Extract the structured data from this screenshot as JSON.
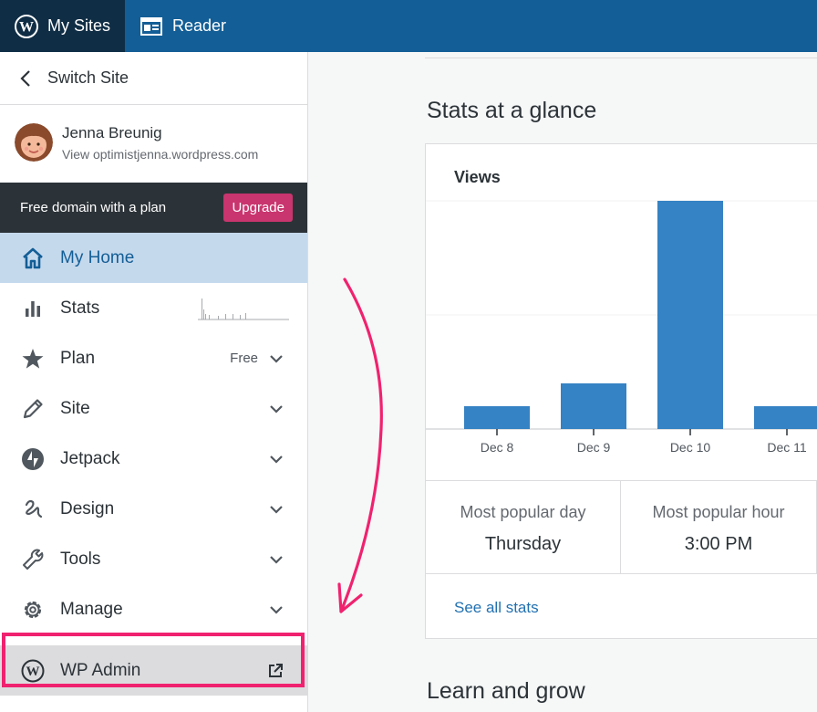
{
  "masterbar": {
    "my_sites": "My Sites",
    "reader": "Reader"
  },
  "sidebar": {
    "switch_site": "Switch Site",
    "site": {
      "name": "Jenna Breunig",
      "url": "View optimistjenna.wordpress.com"
    },
    "upsell": {
      "text": "Free domain with a plan",
      "button": "Upgrade"
    },
    "items": [
      {
        "label": "My Home",
        "icon": "home-icon"
      },
      {
        "label": "Stats",
        "icon": "stats-icon"
      },
      {
        "label": "Plan",
        "icon": "star-icon",
        "badge": "Free"
      },
      {
        "label": "Site",
        "icon": "pencil-icon"
      },
      {
        "label": "Jetpack",
        "icon": "jetpack-icon"
      },
      {
        "label": "Design",
        "icon": "design-icon"
      },
      {
        "label": "Tools",
        "icon": "wrench-icon"
      },
      {
        "label": "Manage",
        "icon": "gear-icon"
      },
      {
        "label": "WP Admin",
        "icon": "wordpress-icon"
      }
    ]
  },
  "main": {
    "stats_title": "Stats at a glance",
    "card_title": "Views",
    "popular_day_label": "Most popular day",
    "popular_day_value": "Thursday",
    "popular_hour_label": "Most popular hour",
    "popular_hour_value": "3:00 PM",
    "see_all": "See all stats",
    "learn_title": "Learn and grow"
  },
  "colors": {
    "masterbar": "#135e96",
    "bar": "#3582c4",
    "accent_pink": "#f0226f",
    "upgrade": "#c9356e"
  },
  "chart_data": {
    "type": "bar",
    "categories": [
      "Dec 8",
      "Dec 9",
      "Dec 10",
      "Dec 11"
    ],
    "values": [
      1,
      2,
      10,
      1
    ],
    "ylim": [
      0,
      10
    ],
    "title": "Views"
  }
}
